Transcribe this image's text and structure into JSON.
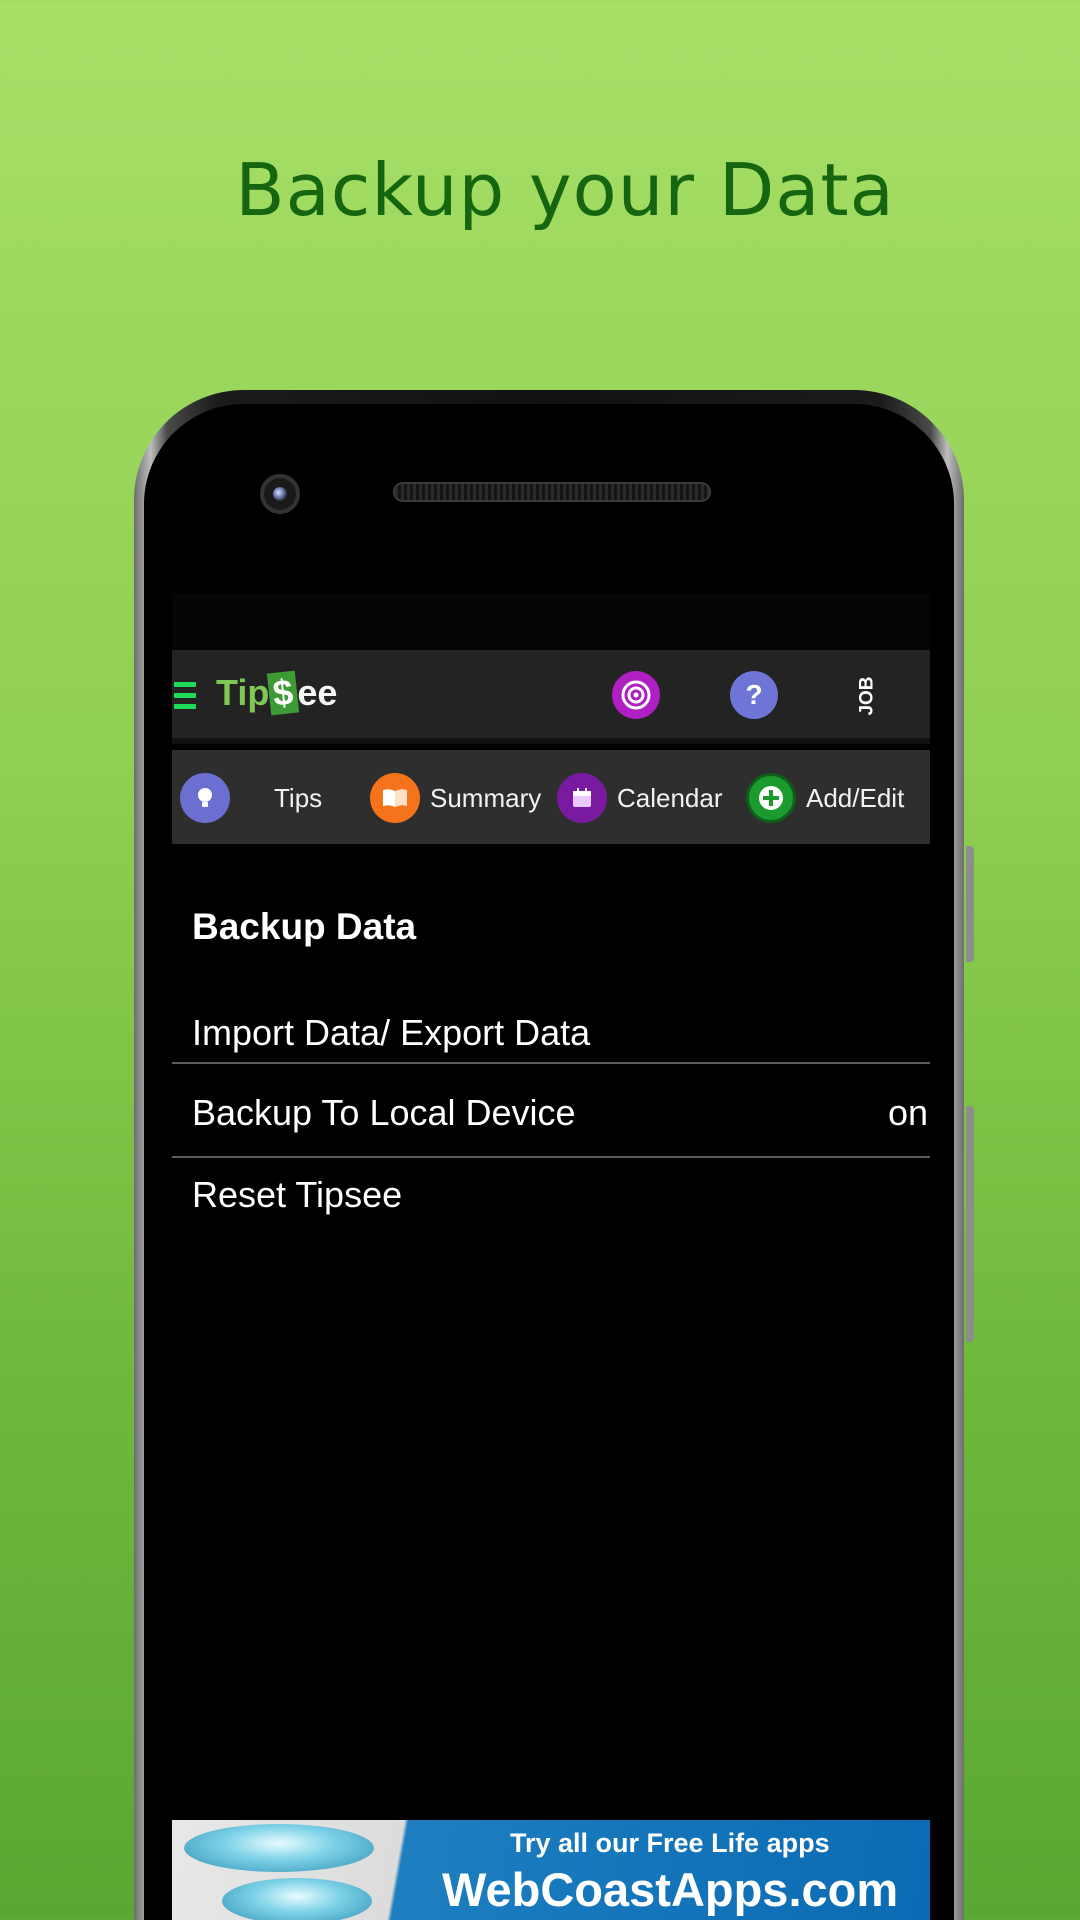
{
  "headline": "Backup your Data",
  "app": {
    "logo": {
      "part1": "Tip",
      "part2": "$",
      "part3": "ee"
    },
    "job_label": "JOB",
    "help_glyph": "?"
  },
  "tabs": [
    {
      "label": "Tips",
      "icon": "lightbulb-icon",
      "color": "#6b70d0"
    },
    {
      "label": "Summary",
      "icon": "book-icon",
      "color": "#f5731a"
    },
    {
      "label": "Calendar",
      "icon": "calendar-icon",
      "color": "#7a1aa0"
    },
    {
      "label": "Add/Edit",
      "icon": "plus-icon",
      "color": "#1b9a2e"
    }
  ],
  "settings": {
    "title": "Backup Data",
    "rows": [
      {
        "label": "Import Data/ Export Data",
        "value": ""
      },
      {
        "label": "Backup To Local Device",
        "value": "on"
      },
      {
        "label": "Reset Tipsee",
        "value": ""
      }
    ]
  },
  "ad": {
    "line1": "Try all our Free Life apps",
    "line2": "WebCoastApps.com"
  },
  "colors": {
    "background_top": "#a7df67",
    "background_bottom": "#5aa832",
    "headline": "#166611",
    "appbar": "#232323",
    "menu_icon": "#1edc5a"
  }
}
